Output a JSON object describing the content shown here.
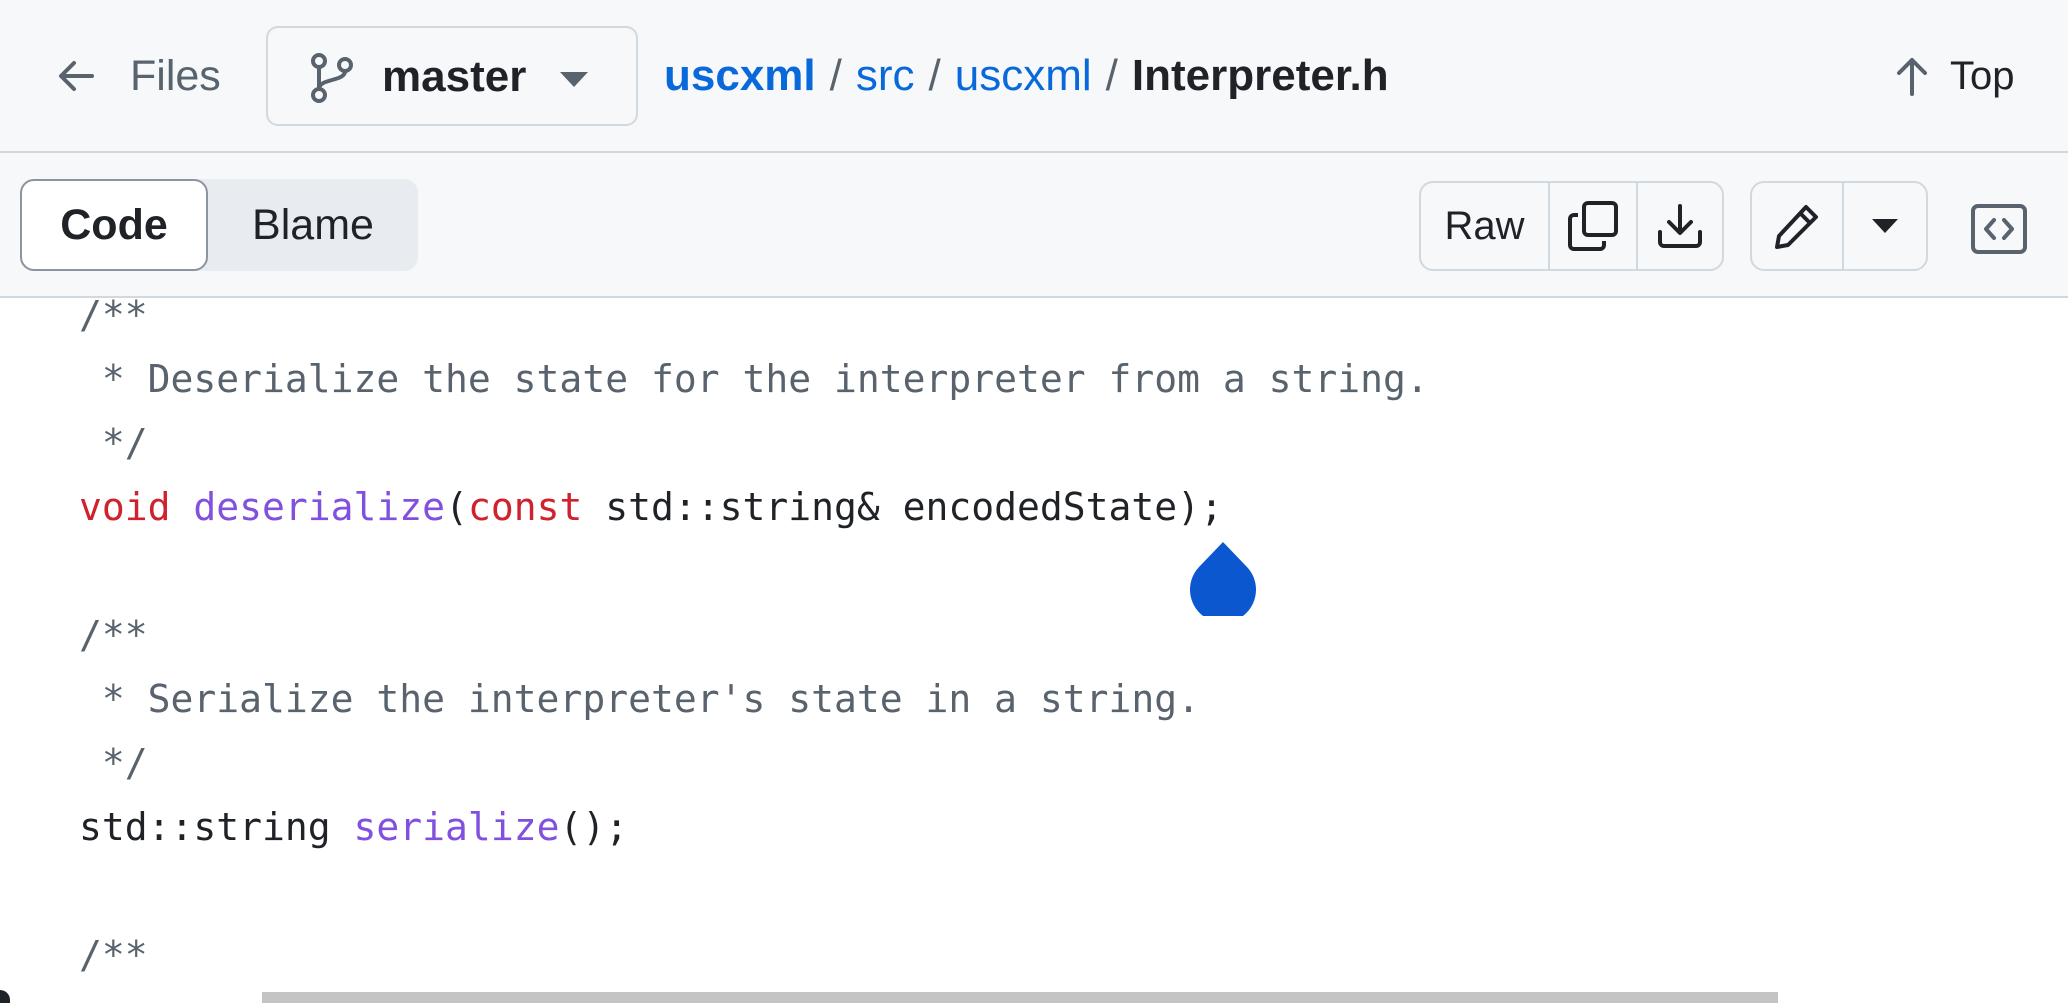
{
  "header": {
    "files_label": "Files",
    "branch": "master",
    "breadcrumb": {
      "root": "uscxml",
      "sep": "/",
      "parts": [
        "src",
        "uscxml"
      ],
      "file": "Interpreter.h"
    },
    "top_label": "Top"
  },
  "toolbar": {
    "tabs": [
      "Code",
      "Blame"
    ],
    "active_tab": "Code",
    "raw_label": "Raw"
  },
  "code": {
    "lines": [
      [
        {
          "t": "/**",
          "c": "cm"
        }
      ],
      [
        {
          "t": " * Deserialize the state for the interpreter from a string.",
          "c": "cm"
        }
      ],
      [
        {
          "t": " */",
          "c": "cm"
        }
      ],
      [
        {
          "t": "void",
          "c": "kw"
        },
        {
          "t": " ",
          "c": ""
        },
        {
          "t": "deserialize",
          "c": "fn"
        },
        {
          "t": "(",
          "c": ""
        },
        {
          "t": "const",
          "c": "kw"
        },
        {
          "t": " std::string& encodedState);",
          "c": ""
        }
      ],
      [],
      [
        {
          "t": "/**",
          "c": "cm"
        }
      ],
      [
        {
          "t": " * Serialize the interpreter's state in a string.",
          "c": "cm"
        }
      ],
      [
        {
          "t": " */",
          "c": "cm"
        }
      ],
      [
        {
          "t": "std::string ",
          "c": ""
        },
        {
          "t": "serialize",
          "c": "fn"
        },
        {
          "t": "();",
          "c": ""
        }
      ],
      [],
      [
        {
          "t": "/**",
          "c": "cm"
        }
      ]
    ]
  },
  "colors": {
    "link": "#0969da",
    "keyword": "#cf222e",
    "function": "#8250df",
    "comment": "#59636e",
    "cursor_drop": "#0b57d0"
  }
}
